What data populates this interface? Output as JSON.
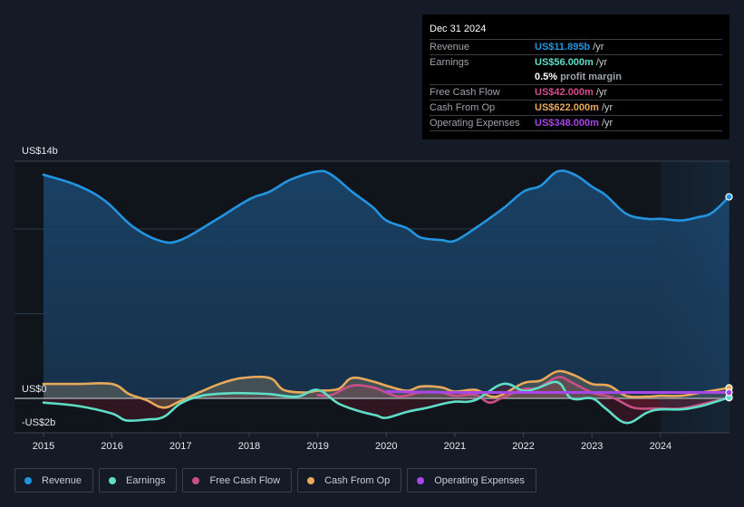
{
  "tooltip": {
    "date": "Dec 31 2024",
    "rows": [
      {
        "label": "Revenue",
        "value": "US$11.895b",
        "unit": "/yr",
        "color": "#2394df"
      },
      {
        "label": "Earnings",
        "value": "US$56.000m",
        "unit": "/yr",
        "color": "#5fdec7"
      },
      {
        "label": "",
        "value": "0.5%",
        "unit": "profit margin",
        "color": "#ffffff"
      },
      {
        "label": "Free Cash Flow",
        "value": "US$42.000m",
        "unit": "/yr",
        "color": "#d64d8c"
      },
      {
        "label": "Cash From Op",
        "value": "US$622.000m",
        "unit": "/yr",
        "color": "#e8aa5a"
      },
      {
        "label": "Operating Expenses",
        "value": "US$348.000m",
        "unit": "/yr",
        "color": "#a647e6"
      }
    ]
  },
  "legend": [
    {
      "label": "Revenue",
      "color": "#2394df"
    },
    {
      "label": "Earnings",
      "color": "#5fdec7"
    },
    {
      "label": "Free Cash Flow",
      "color": "#c94f87"
    },
    {
      "label": "Cash From Op",
      "color": "#e8aa5a"
    },
    {
      "label": "Operating Expenses",
      "color": "#a647e6"
    }
  ],
  "chart_data": {
    "type": "area",
    "title": "",
    "xlabel": "",
    "ylabel": "",
    "y_tick_labels": [
      {
        "value": 14,
        "label": "US$14b"
      },
      {
        "value": 0,
        "label": "US$0"
      },
      {
        "value": -2,
        "label": "-US$2b"
      }
    ],
    "x_tick_labels": [
      "2015",
      "2016",
      "2017",
      "2018",
      "2019",
      "2020",
      "2021",
      "2022",
      "2023",
      "2024"
    ],
    "xlim": [
      2014.55,
      2025.0
    ],
    "ylim": [
      -2.4,
      14
    ],
    "gridlines_y": [
      14,
      10,
      5,
      0
    ],
    "grid": true,
    "highlight_region": [
      2024.0,
      2025.0
    ],
    "units": "US$ billions",
    "series": [
      {
        "name": "Revenue",
        "color": "#2394df",
        "x": [
          2015.0,
          2015.5,
          2015.9,
          2016.3,
          2016.7,
          2017.0,
          2017.5,
          2018.0,
          2018.3,
          2018.6,
          2019.0,
          2019.2,
          2019.5,
          2019.8,
          2020.0,
          2020.3,
          2020.5,
          2020.8,
          2021.0,
          2021.3,
          2021.7,
          2022.0,
          2022.25,
          2022.5,
          2022.75,
          2023.0,
          2023.2,
          2023.5,
          2023.8,
          2024.0,
          2024.3,
          2024.55,
          2024.75,
          2025.0
        ],
        "values": [
          13.2,
          12.56,
          11.65,
          10.15,
          9.3,
          9.35,
          10.5,
          11.75,
          12.2,
          12.9,
          13.4,
          13.2,
          12.2,
          11.3,
          10.5,
          10.05,
          9.5,
          9.35,
          9.3,
          10.05,
          11.2,
          12.2,
          12.55,
          13.4,
          13.2,
          12.5,
          12.0,
          10.9,
          10.6,
          10.6,
          10.5,
          10.7,
          10.95,
          11.895
        ]
      },
      {
        "name": "Earnings",
        "color": "#5fdec7",
        "x": [
          2015.0,
          2015.5,
          2016.0,
          2016.2,
          2016.5,
          2016.75,
          2017.0,
          2017.3,
          2017.7,
          2018.0,
          2018.3,
          2018.7,
          2019.0,
          2019.3,
          2019.6,
          2019.85,
          2020.0,
          2020.3,
          2020.6,
          2020.85,
          2021.0,
          2021.3,
          2021.7,
          2022.0,
          2022.2,
          2022.5,
          2022.7,
          2023.0,
          2023.2,
          2023.5,
          2023.8,
          2024.0,
          2024.3,
          2024.6,
          2025.0
        ],
        "values": [
          -0.25,
          -0.45,
          -0.9,
          -1.3,
          -1.25,
          -1.1,
          -0.3,
          0.15,
          0.3,
          0.3,
          0.25,
          0.1,
          0.5,
          -0.3,
          -0.75,
          -1.0,
          -1.15,
          -0.8,
          -0.55,
          -0.3,
          -0.2,
          -0.1,
          0.85,
          0.45,
          0.6,
          0.95,
          0.0,
          0.0,
          -0.6,
          -1.45,
          -0.85,
          -0.65,
          -0.65,
          -0.45,
          0.056
        ]
      },
      {
        "name": "Free Cash Flow",
        "color": "#c94f87",
        "x": [
          2019.0,
          2019.2,
          2019.5,
          2019.8,
          2020.0,
          2020.2,
          2020.5,
          2020.8,
          2021.0,
          2021.3,
          2021.5,
          2021.7,
          2022.0,
          2022.2,
          2022.5,
          2022.7,
          2023.0,
          2023.3,
          2023.6,
          2023.9,
          2024.0,
          2024.3,
          2024.6,
          2025.0
        ],
        "values": [
          0.2,
          0.2,
          0.75,
          0.65,
          0.35,
          0.1,
          0.35,
          0.35,
          0.15,
          0.2,
          -0.25,
          0.05,
          0.55,
          0.6,
          1.25,
          0.95,
          0.35,
          0.05,
          -0.55,
          -0.6,
          -0.6,
          -0.6,
          -0.35,
          0.042
        ]
      },
      {
        "name": "Cash From Op",
        "color": "#e8aa5a",
        "x": [
          2015.0,
          2015.5,
          2016.0,
          2016.25,
          2016.5,
          2016.75,
          2017.0,
          2017.3,
          2017.6,
          2017.9,
          2018.3,
          2018.5,
          2018.8,
          2019.0,
          2019.3,
          2019.5,
          2019.8,
          2020.0,
          2020.3,
          2020.5,
          2020.8,
          2021.0,
          2021.3,
          2021.6,
          2022.0,
          2022.25,
          2022.5,
          2022.75,
          2023.0,
          2023.25,
          2023.5,
          2023.8,
          2024.0,
          2024.3,
          2024.6,
          2025.0
        ],
        "values": [
          0.85,
          0.85,
          0.85,
          0.25,
          -0.1,
          -0.55,
          -0.15,
          0.4,
          0.9,
          1.2,
          1.2,
          0.5,
          0.35,
          0.45,
          0.55,
          1.2,
          1.0,
          0.75,
          0.45,
          0.7,
          0.65,
          0.4,
          0.5,
          0.1,
          0.9,
          1.05,
          1.6,
          1.35,
          0.85,
          0.75,
          0.15,
          0.1,
          0.15,
          0.15,
          0.35,
          0.622
        ]
      },
      {
        "name": "Operating Expenses",
        "color": "#a647e6",
        "x": [
          2020.0,
          2021.0,
          2022.0,
          2023.0,
          2024.0,
          2025.0
        ],
        "values": [
          0.4,
          0.35,
          0.35,
          0.35,
          0.35,
          0.348
        ]
      }
    ]
  }
}
